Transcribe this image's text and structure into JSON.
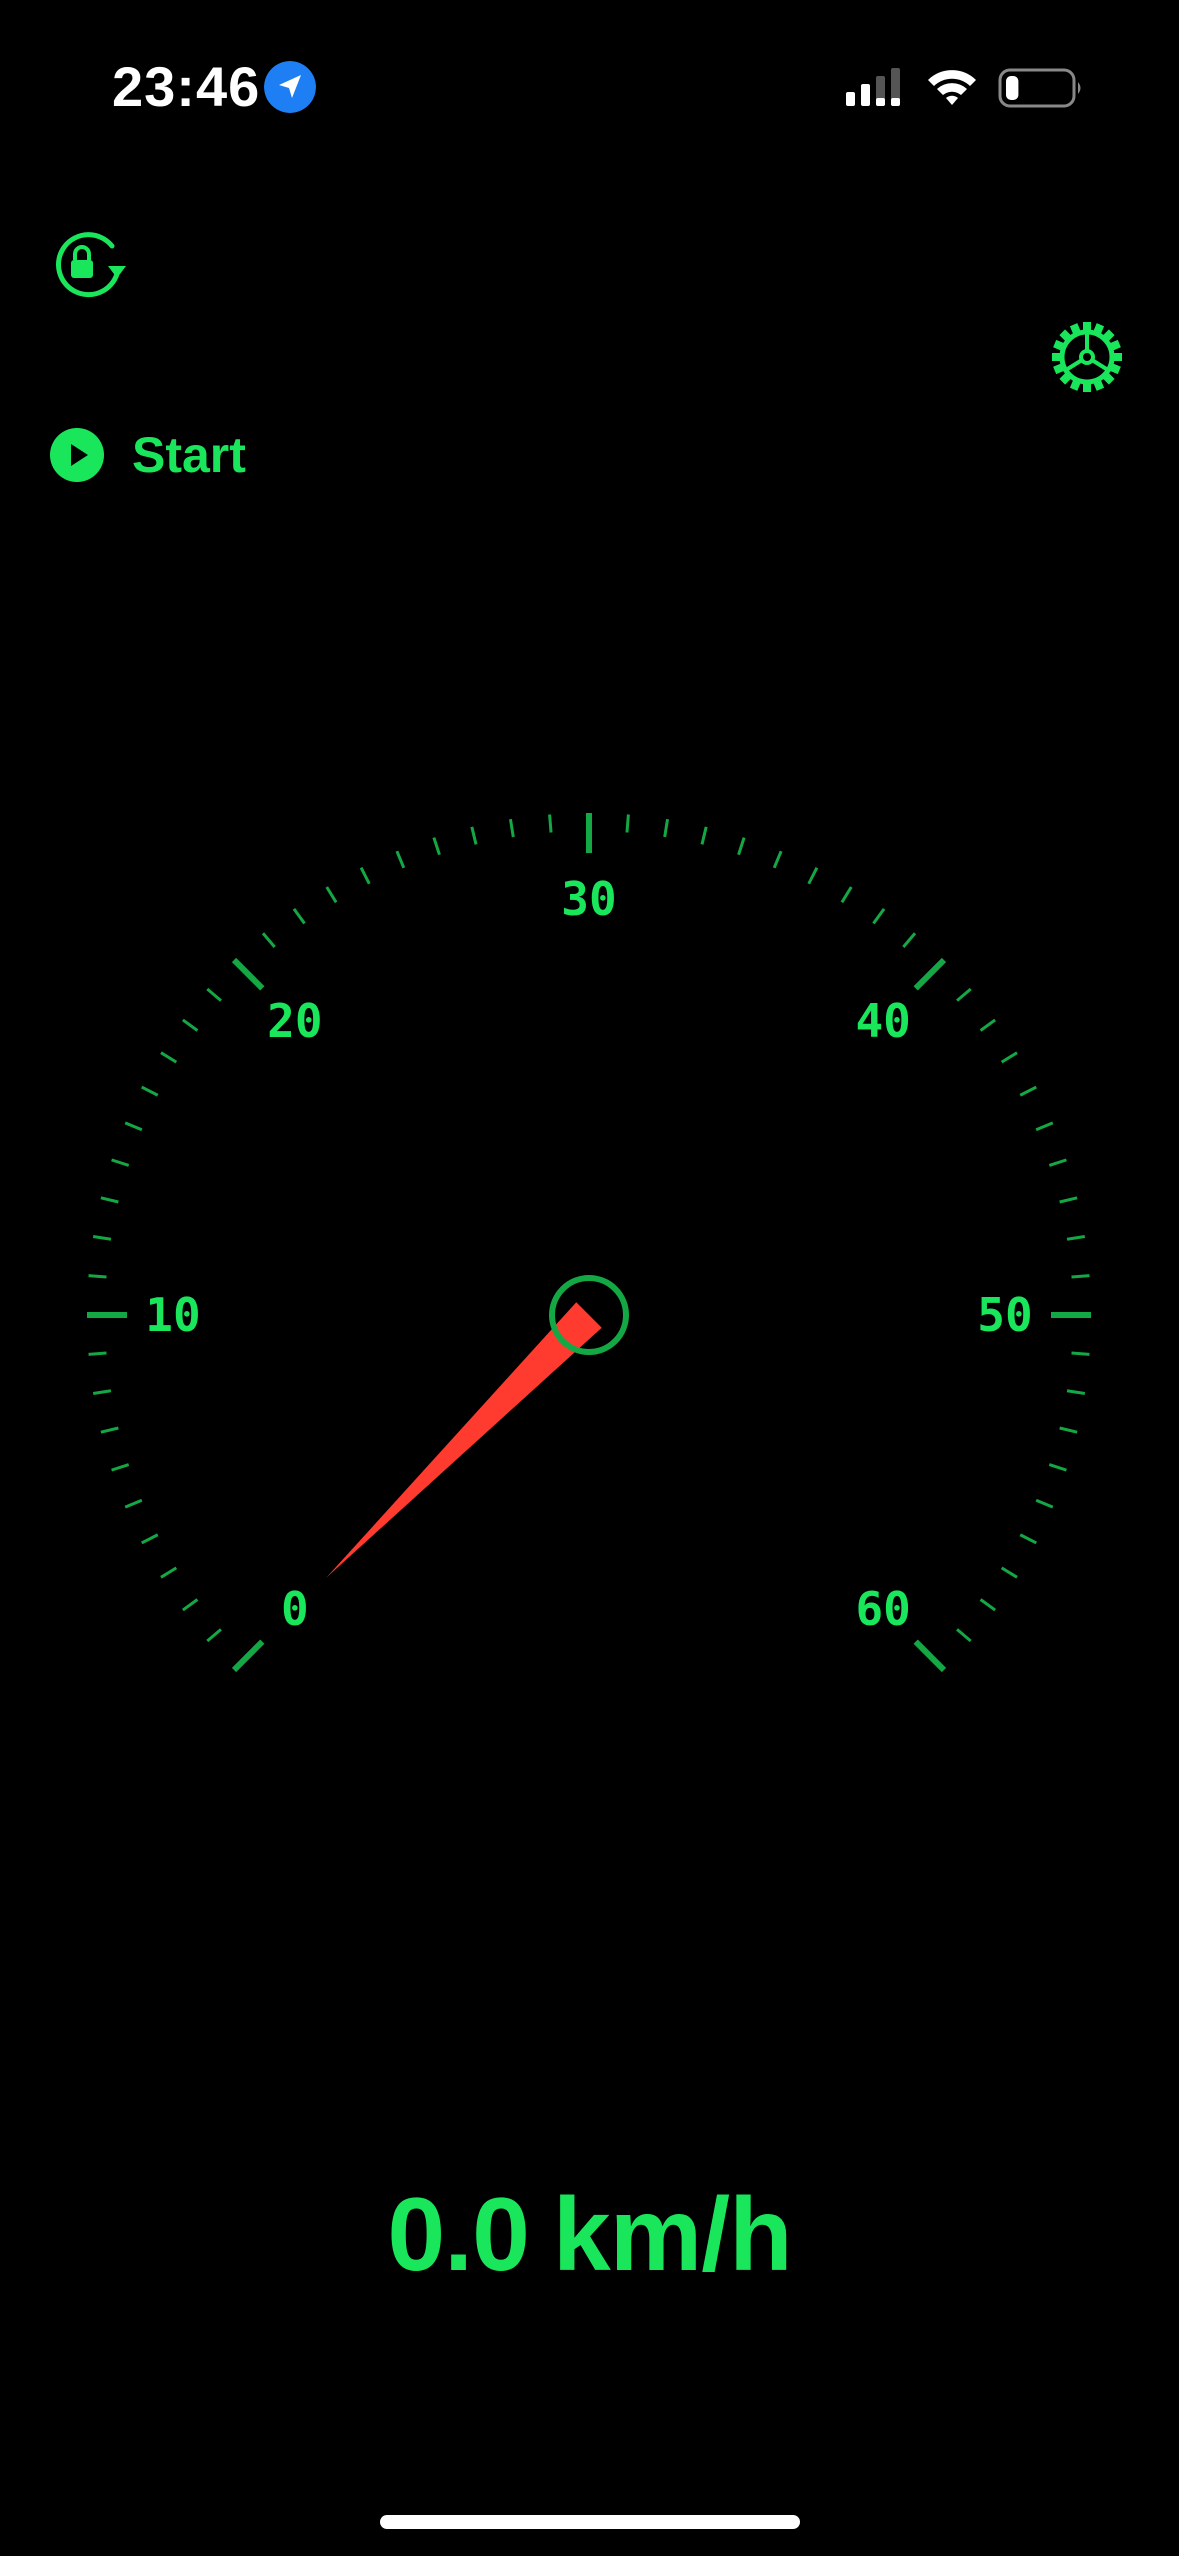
{
  "status_bar": {
    "time": "23:46",
    "location_icon": "location-arrow-icon",
    "signal_icon": "cellular-signal-icon",
    "wifi_icon": "wifi-icon",
    "battery_icon": "battery-icon",
    "battery_level": 0.2
  },
  "toolbar": {
    "rotation_lock_icon": "rotation-lock-icon",
    "settings_icon": "gear-icon",
    "start_icon": "play-circle-icon",
    "start_label": "Start"
  },
  "gauge": {
    "min": 0,
    "max": 60,
    "major_step": 10,
    "minor_step": 1,
    "tick_labels": [
      "0",
      "10",
      "20",
      "30",
      "40",
      "50",
      "60"
    ],
    "needle_value": 0,
    "needle_icon": "speed-needle-icon"
  },
  "readout": {
    "value": "0.0",
    "unit": "km/h"
  },
  "colors": {
    "accent": "#19e65b",
    "tick": "#14a845",
    "needle": "#ff3b30",
    "background": "#000000",
    "location_badge": "#1e7ff5"
  }
}
